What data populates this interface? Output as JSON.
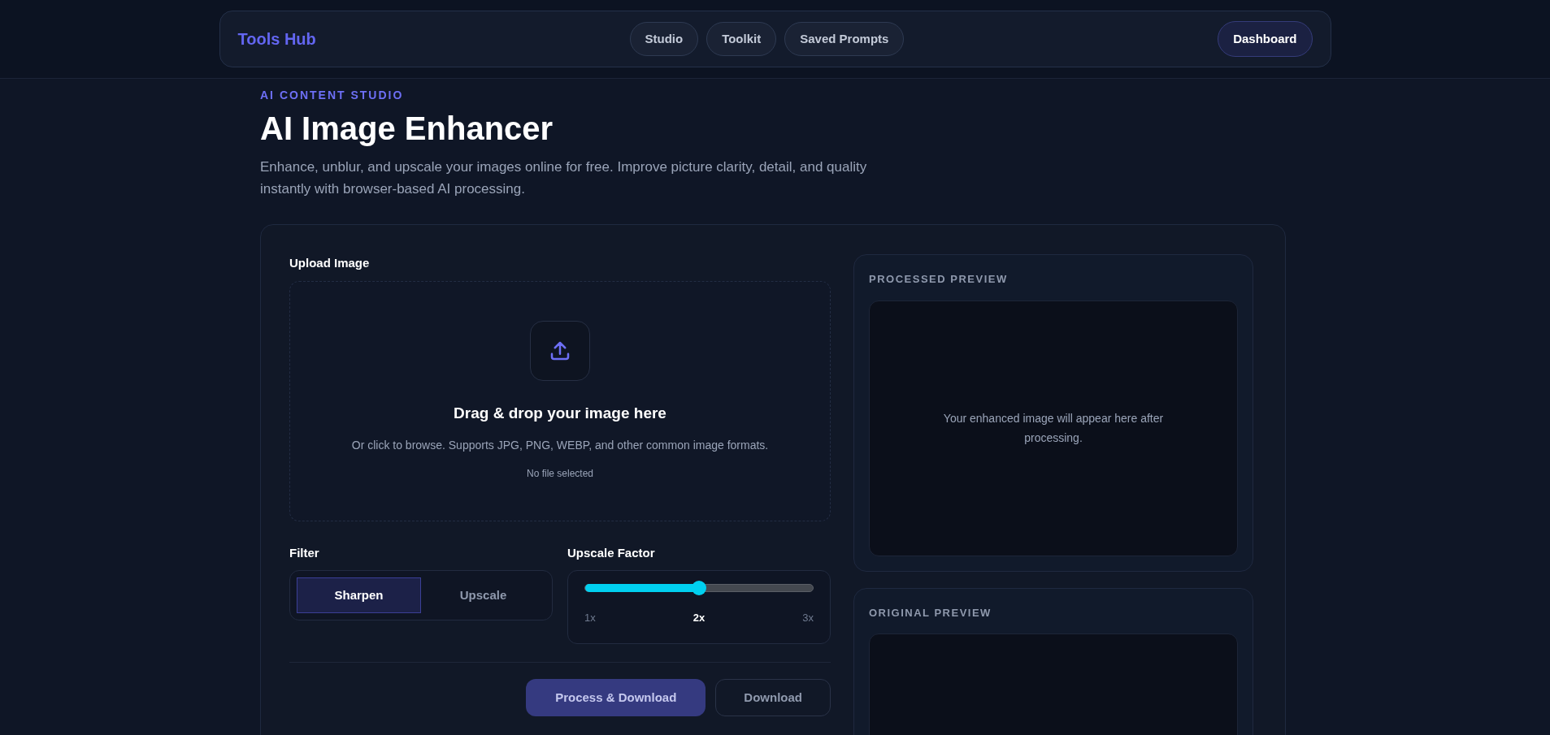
{
  "header": {
    "brand": "Tools Hub",
    "nav": [
      {
        "label": "Studio"
      },
      {
        "label": "Toolkit"
      },
      {
        "label": "Saved Prompts"
      }
    ],
    "action": "Dashboard"
  },
  "hero": {
    "eyebrow": "AI CONTENT STUDIO",
    "title": "AI Image Enhancer",
    "description": "Enhance, unblur, and upscale your images online for free. Improve picture clarity, detail, and quality instantly with browser-based AI processing."
  },
  "upload": {
    "label": "Upload Image",
    "heading": "Drag & drop your image here",
    "hint": "Or click to browse. Supports JPG, PNG, WEBP, and other common image formats.",
    "status": "No file selected"
  },
  "filter": {
    "label": "Filter",
    "options": [
      {
        "label": "Sharpen",
        "selected": true
      },
      {
        "label": "Upscale",
        "selected": false
      }
    ]
  },
  "upscale": {
    "label": "Upscale Factor",
    "level": 0.5,
    "ticks": [
      {
        "label": "1x",
        "selected": false
      },
      {
        "label": "2x",
        "selected": true
      },
      {
        "label": "3x",
        "selected": false
      }
    ]
  },
  "actions": [
    {
      "label": "Process & Download",
      "kind": "primary"
    },
    {
      "label": "Download",
      "kind": "secondary"
    }
  ],
  "previews": [
    {
      "title": "PROCESSED PREVIEW",
      "message": "Your enhanced image will appear here after processing."
    },
    {
      "title": "ORIGINAL PREVIEW"
    }
  ]
}
